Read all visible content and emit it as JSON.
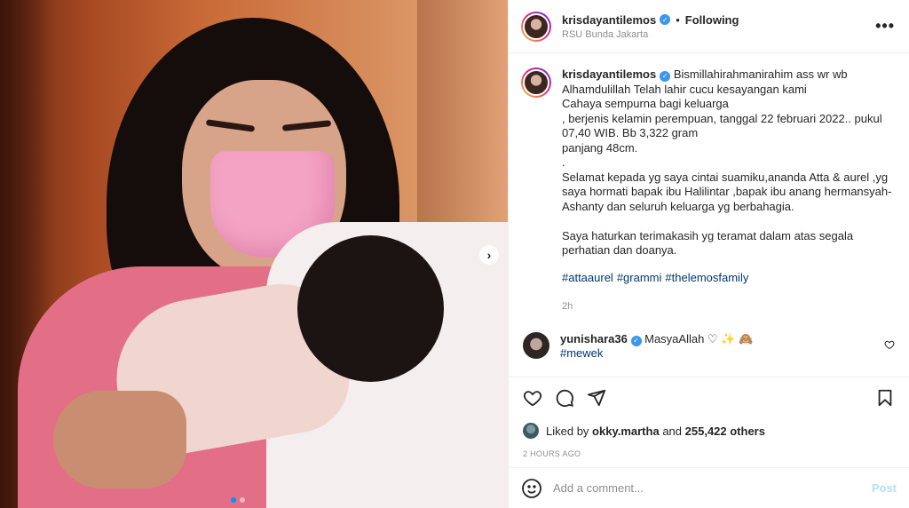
{
  "header": {
    "username": "krisdayantilemos",
    "separator": "•",
    "follow_state": "Following",
    "location": "RSU Bunda Jakarta",
    "more_label": "•••"
  },
  "media": {
    "next_arrow": "›"
  },
  "caption": {
    "username": "krisdayantilemos",
    "text": "Bismillahirahmanirahim ass wr wb\nAlhamdulillah Telah lahir cucu kesayangan kami\nCahaya sempurna bagi keluarga\n, berjenis kelamin perempuan, tanggal 22 februari 2022.. pukul 07,40 WIB. Bb 3,322 gram\npanjang 48cm.\n.\nSelamat kepada yg saya cintai suamiku,ananda Atta & aurel ,yg saya hormati bapak ibu Halilintar ,bapak ibu anang hermansyah-Ashanty dan seluruh keluarga yg berbahagia.\n\nSaya haturkan terimakasih yg teramat dalam atas segala perhatian dan doanya.",
    "hashtags": [
      "#attaaurel",
      "#grammi",
      "#thelemosfamily"
    ],
    "time": "2h"
  },
  "comment": {
    "username": "yunishara36",
    "text": "MasyaAllah ♡ ✨ 🙈",
    "hashtag": "#mewek"
  },
  "likes": {
    "prefix": "Liked by",
    "user": "okky.martha",
    "joiner": "and",
    "others": "255,422 others"
  },
  "timestamp": "2 HOURS AGO",
  "add_comment": {
    "placeholder": "Add a comment...",
    "post_label": "Post"
  }
}
